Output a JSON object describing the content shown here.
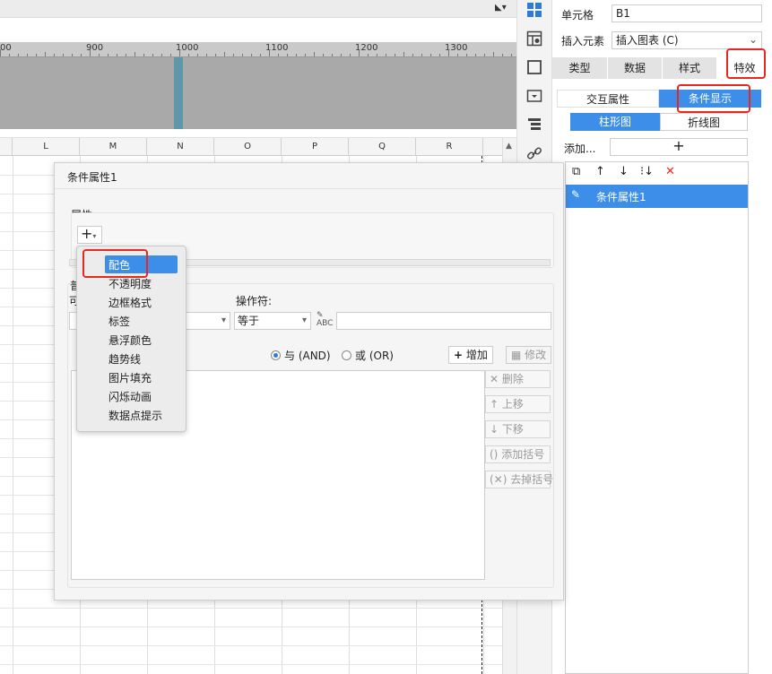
{
  "ruler": {
    "labels": [
      "00",
      "900",
      "1000",
      "1100",
      "1200",
      "1300"
    ]
  },
  "columns": [
    "L",
    "M",
    "N",
    "O",
    "P",
    "Q",
    "R"
  ],
  "panel": {
    "cell_label": "单元格",
    "cell_value": "B1",
    "insert_label": "插入元素",
    "insert_value": "插入图表 (C)",
    "tabs": [
      "类型",
      "数据",
      "样式",
      "特效"
    ],
    "subtabs": [
      "交互属性",
      "条件显示"
    ],
    "chart_tabs": [
      "柱形图",
      "折线图"
    ],
    "add_label": "添加...",
    "add_plus": "+",
    "list_item": "条件属性1"
  },
  "dialog": {
    "title": "条件属性1",
    "attr_label": "属性:",
    "common_label_partial": "普",
    "var_label_partial": "可",
    "operator_label": "操作符:",
    "operator_value": "等于",
    "and_label": "与 (AND)",
    "or_label": "或 (OR)",
    "add_button": "增加",
    "modify_button": "修改",
    "delete_button": "删除",
    "up_button": "上移",
    "down_button": "下移",
    "add_bracket_button": "添加括号",
    "remove_bracket_button": "去掉括号"
  },
  "menu": {
    "items": [
      "配色",
      "不透明度",
      "边框格式",
      "标签",
      "悬浮颜色",
      "趋势线",
      "图片填充",
      "闪烁动画",
      "数据点提示"
    ]
  },
  "colors": {
    "accent": "#3d8ee8",
    "highlight_border": "#e8281f",
    "delete_x": "#e8281f"
  }
}
